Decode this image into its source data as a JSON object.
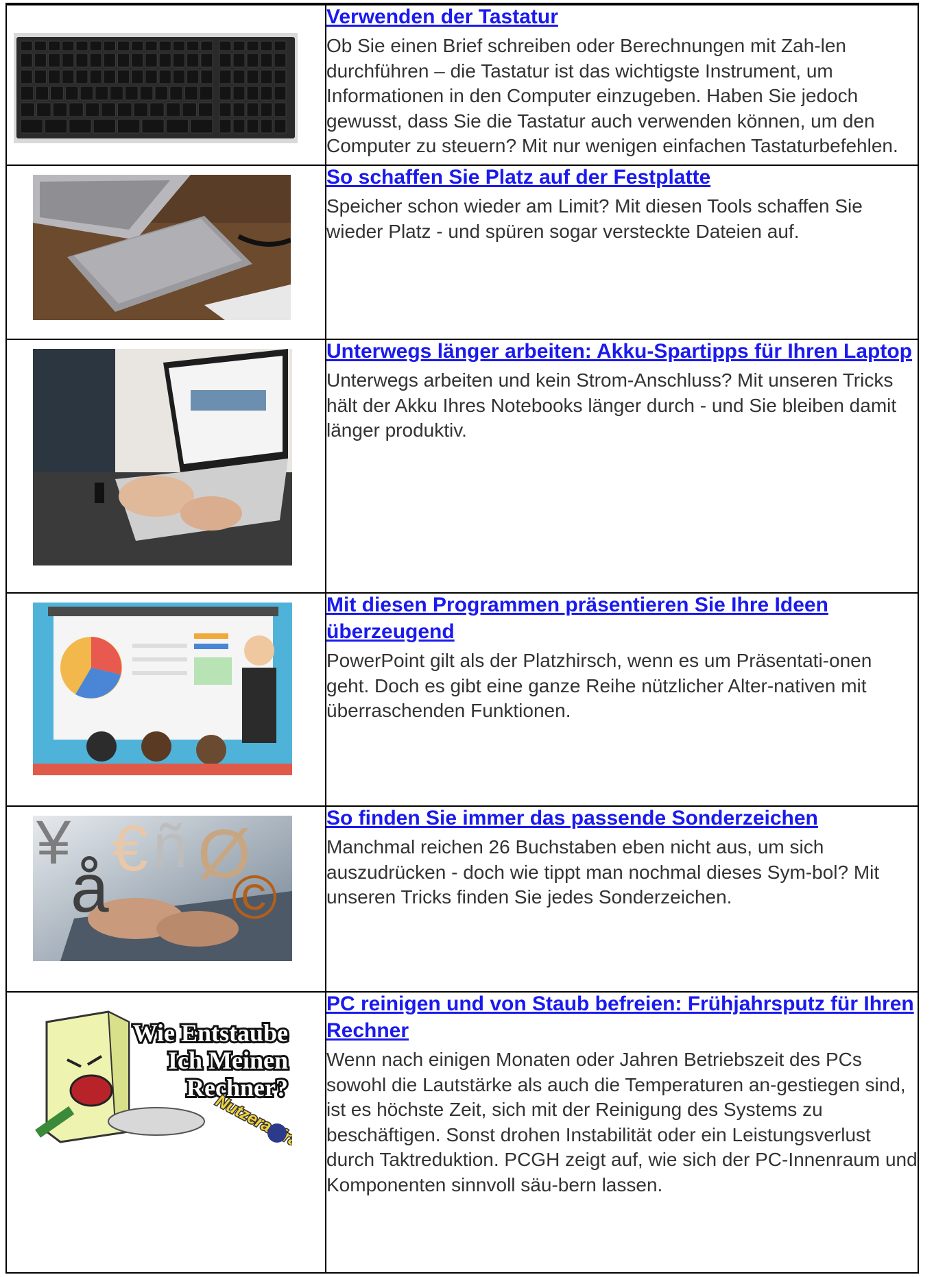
{
  "articles": [
    {
      "title": "Verwenden der Tastatur",
      "description": "Ob Sie einen Brief schreiben oder Berechnungen mit Zah-len durchführen – die Tastatur ist das wichtigste Instrument, um Informationen in den Computer einzugeben. Haben Sie jedoch gewusst, dass Sie die Tastatur auch verwenden können, um den Computer zu steuern? Mit nur wenigen einfachen Tastaturbefehlen.",
      "image": "keyboard-photo"
    },
    {
      "title": "So schaffen Sie Platz auf der Festplatte",
      "description": "Speicher schon wieder am Limit? Mit diesen Tools schaffen Sie wieder Platz - und spüren sogar versteckte Dateien auf.",
      "image": "external-hard-drive-photo"
    },
    {
      "title": "Unterwegs länger arbeiten: Akku-Spartipps für Ihren Laptop",
      "description": "Unterwegs arbeiten und kein Strom-Anschluss? Mit unseren Tricks hält der Akku Ihres Notebooks länger durch - und Sie bleiben damit länger produktiv.",
      "image": "laptop-user-photo"
    },
    {
      "title": "Mit diesen Programmen präsentieren Sie Ihre Ideen überzeugend",
      "description": "PowerPoint gilt als der Platzhirsch, wenn es um Präsentati-onen geht. Doch es gibt eine ganze Reihe nützlicher Alter-nativen mit überraschenden Funktionen.",
      "image": "presentation-illustration"
    },
    {
      "title": "So finden Sie immer das passende Sonderzeichen",
      "description": "Manchmal reichen 26 Buchstaben eben nicht aus, um sich auszudrücken - doch wie tippt man nochmal dieses Sym-bol? Mit unseren Tricks finden Sie jedes Sonderzeichen.",
      "image": "special-characters-photo",
      "image_glyphs": [
        "¥",
        "å",
        "€",
        "ñ",
        "Ø",
        "©"
      ]
    },
    {
      "title": "PC reinigen und von Staub befreien: Frühjahrsputz für Ihren Rechner",
      "description": "Wenn nach einigen Monaten oder Jahren Betriebszeit des PCs sowohl die Lautstärke als auch die Temperaturen an-gestiegen sind, ist es höchste Zeit, sich mit der Reinigung des Systems zu beschäftigen. Sonst drohen Instabilität oder ein Leistungsverlust durch Taktreduktion. PCGH zeigt auf, wie sich der PC-Innenraum und Komponenten sinnvoll säu-bern lassen.",
      "image": "dusty-pc-cartoon",
      "image_text": {
        "line1": "Wie Entstaube",
        "line2": "Ich Meinen",
        "line3": "Rechner?",
        "banner": "Nutzeranfrage"
      }
    }
  ],
  "colors": {
    "link": "#1a1aee",
    "border": "#000000",
    "text": "#333333"
  }
}
